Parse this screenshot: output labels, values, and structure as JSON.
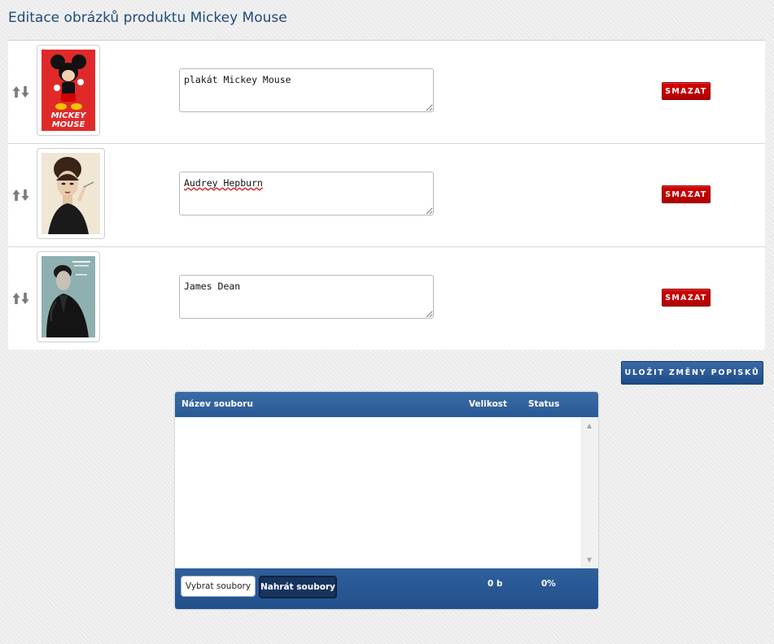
{
  "page": {
    "title": "Editace obrázků produktu Mickey Mouse"
  },
  "images": [
    {
      "description": "plakát Mickey Mouse",
      "delete_label": "SMAZAT",
      "thumbnail": "mickey-mouse-poster"
    },
    {
      "description": "Audrey Hepburn",
      "delete_label": "SMAZAT",
      "thumbnail": "audrey-hepburn-poster"
    },
    {
      "description": "James Dean",
      "delete_label": "SMAZAT",
      "thumbnail": "james-dean-poster"
    }
  ],
  "actions": {
    "save_label": "ULOŽIT ZMĚNY POPISKŮ"
  },
  "uploader": {
    "columns": {
      "filename": "Název souboru",
      "size": "Velikost",
      "status": "Status"
    },
    "choose_label": "Vybrat soubory",
    "upload_label": "Nahrát soubory",
    "total_size": "0 b",
    "total_status": "0%"
  },
  "colors": {
    "title": "#1f4a7a",
    "delete_button": "#c40000",
    "primary_blue": "#2a5a95",
    "upload_button": "#17345e"
  },
  "icons": {
    "drag_handle": "sort-arrows-icon",
    "scroll_up": "scroll-up-arrow-icon",
    "scroll_down": "scroll-down-arrow-icon"
  }
}
